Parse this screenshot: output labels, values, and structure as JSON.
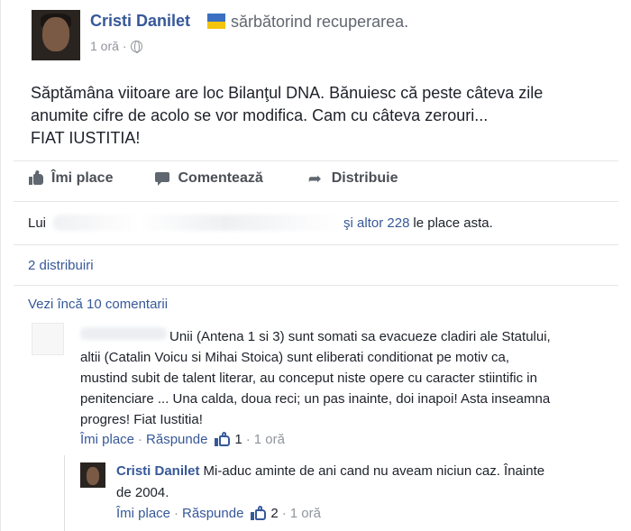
{
  "post": {
    "author": "Cristi Danilet",
    "activity": "sărbătorind recuperarea.",
    "time": "1 oră",
    "separator": "·",
    "text_lines": [
      "Săptămâna viitoare are loc Bilanţul DNA. Bănuiesc că peste câteva zile",
      "anumite cifre de acolo se vor modifica. Cam cu câteva zerouri...",
      "FIAT IUSTITIA!"
    ],
    "flag_colors": [
      "#3b6fc2",
      "#f2c40d"
    ]
  },
  "actions": {
    "like": "Îmi place",
    "comment": "Comentează",
    "share": "Distribuie"
  },
  "likes": {
    "prefix": "Lui",
    "and_others": "şi altor 228",
    "suffix": "le place asta."
  },
  "shares": "2 distribuiri",
  "more_comments": "Vezi încă 10 comentarii",
  "comment1": {
    "lines": [
      "Unii (Antena 1 si 3) sunt somati sa evacueze cladiri ale Statului,",
      "altii (Catalin Voicu si Mihai Stoica) sunt eliberati conditionat pe motiv ca,",
      "mustind subit de talent literar, au conceput niste opere cu caracter stiintific in",
      "penitenciare ... Una calda, doua reci; un pas inainte, doi inapoi! Asta inseamna",
      "progres! Fiat Iustitia!"
    ],
    "like": "Îmi place",
    "reply": "Răspunde",
    "likes_count": "1",
    "time": "1 oră"
  },
  "reply1": {
    "author": "Cristi Danilet",
    "lines": [
      "Mi-aduc aminte de ani cand nu aveam niciun caz. Înainte",
      "de 2004."
    ],
    "like": "Îmi place",
    "reply": "Răspunde",
    "likes_count": "2",
    "time": "1 oră"
  },
  "colors": {
    "link": "#365899",
    "text": "#1d2129",
    "muted": "#90949c"
  }
}
